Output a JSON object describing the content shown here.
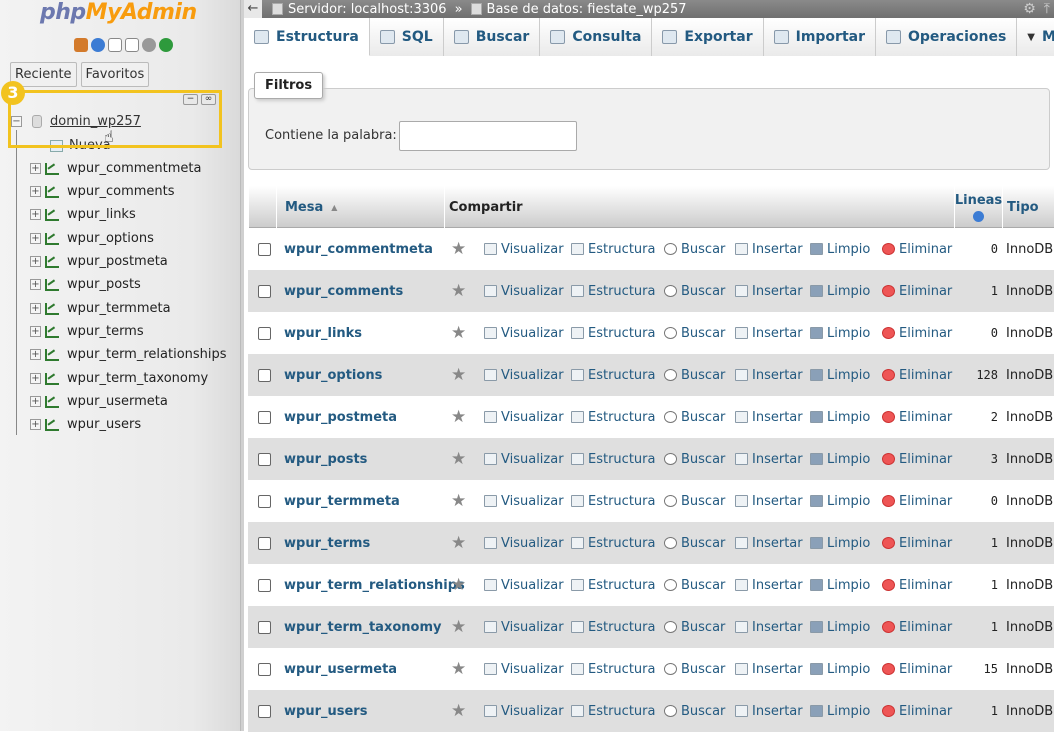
{
  "nav": {
    "logo": {
      "php": "php",
      "my": "My",
      "admin": "Admin"
    },
    "tabs": [
      "Reciente",
      "Favoritos"
    ],
    "badge": "3",
    "database": "domin_wp257",
    "new_label": "Nueva",
    "tables": [
      "wpur_commentmeta",
      "wpur_comments",
      "wpur_links",
      "wpur_options",
      "wpur_postmeta",
      "wpur_posts",
      "wpur_termmeta",
      "wpur_terms",
      "wpur_term_relationships",
      "wpur_term_taxonomy",
      "wpur_usermeta",
      "wpur_users"
    ]
  },
  "breadcrumb": {
    "server": "Servidor: localhost:3306",
    "separator": "»",
    "database": "Base de datos: fiestate_wp257"
  },
  "tabs": [
    "Estructura",
    "SQL",
    "Buscar",
    "Consulta",
    "Exportar",
    "Importar",
    "Operaciones",
    "Más"
  ],
  "filters": {
    "legend": "Filtros",
    "label": "Contiene la palabra:",
    "value": ""
  },
  "table": {
    "headers": {
      "mesa": "Mesa",
      "sort": "▲",
      "compartir": "Compartir",
      "lineas": "Lineas",
      "tipo": "Tipo"
    },
    "actions": [
      "Visualizar",
      "Estructura",
      "Buscar",
      "Insertar",
      "Limpio",
      "Eliminar"
    ],
    "rows": [
      {
        "name": "wpur_commentmeta",
        "lines": "0",
        "type": "InnoDB"
      },
      {
        "name": "wpur_comments",
        "lines": "1",
        "type": "InnoDB"
      },
      {
        "name": "wpur_links",
        "lines": "0",
        "type": "InnoDB"
      },
      {
        "name": "wpur_options",
        "lines": "128",
        "type": "InnoDB"
      },
      {
        "name": "wpur_postmeta",
        "lines": "2",
        "type": "InnoDB"
      },
      {
        "name": "wpur_posts",
        "lines": "3",
        "type": "InnoDB"
      },
      {
        "name": "wpur_termmeta",
        "lines": "0",
        "type": "InnoDB"
      },
      {
        "name": "wpur_terms",
        "lines": "1",
        "type": "InnoDB"
      },
      {
        "name": "wpur_term_relationships",
        "lines": "1",
        "type": "InnoDB"
      },
      {
        "name": "wpur_term_taxonomy",
        "lines": "1",
        "type": "InnoDB"
      },
      {
        "name": "wpur_usermeta",
        "lines": "15",
        "type": "InnoDB"
      },
      {
        "name": "wpur_users",
        "lines": "1",
        "type": "InnoDB"
      }
    ]
  },
  "colors": {
    "link": "#235a81",
    "highlight": "#f2c31f",
    "logo_php": "#6c78af",
    "logo_admin": "#f89c0e"
  }
}
